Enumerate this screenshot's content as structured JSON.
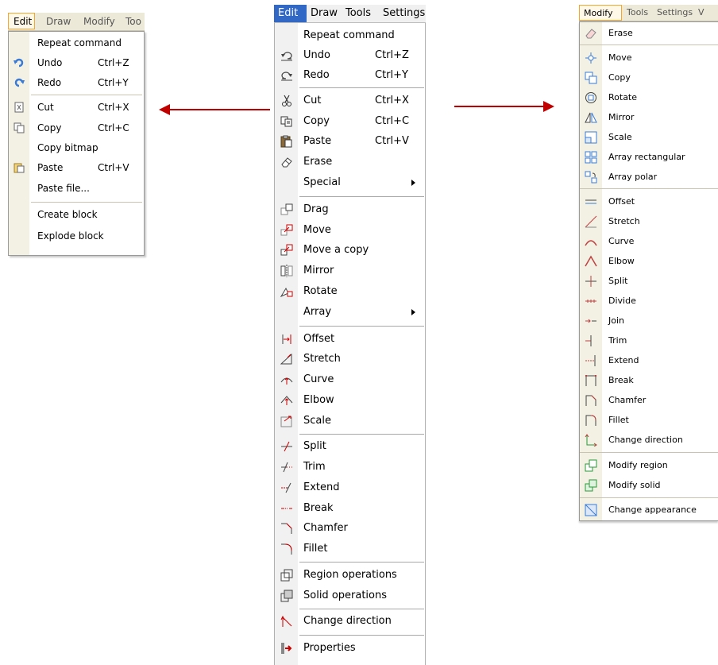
{
  "left_menu": {
    "menubar": [
      "Edit",
      "Draw",
      "Modify",
      "Too"
    ],
    "items": [
      {
        "label": "Repeat command",
        "shortcut": "",
        "icon": "none"
      },
      {
        "label": "Undo",
        "shortcut": "Ctrl+Z",
        "icon": "undo-icon"
      },
      {
        "label": "Redo",
        "shortcut": "Ctrl+Y",
        "icon": "redo-icon"
      },
      {
        "label": "Cut",
        "shortcut": "Ctrl+X",
        "icon": "cut-icon"
      },
      {
        "label": "Copy",
        "shortcut": "Ctrl+C",
        "icon": "copy-icon"
      },
      {
        "label": "Copy bitmap",
        "shortcut": "",
        "icon": "none"
      },
      {
        "label": "Paste",
        "shortcut": "Ctrl+V",
        "icon": "paste-icon"
      },
      {
        "label": "Paste file...",
        "shortcut": "",
        "icon": "none"
      },
      {
        "label": "Create block",
        "shortcut": "",
        "icon": "none"
      },
      {
        "label": "Explode block",
        "shortcut": "",
        "icon": "none"
      }
    ]
  },
  "center_menu": {
    "menubar": [
      "Edit",
      "Draw",
      "Tools",
      "Settings"
    ],
    "items": [
      {
        "label": "Repeat command",
        "shortcut": "",
        "icon": "none"
      },
      {
        "label": "Undo",
        "shortcut": "Ctrl+Z",
        "icon": "undo-icon"
      },
      {
        "label": "Redo",
        "shortcut": "Ctrl+Y",
        "icon": "redo-icon"
      },
      {
        "label": "Cut",
        "shortcut": "Ctrl+X",
        "icon": "scissors-icon"
      },
      {
        "label": "Copy",
        "shortcut": "Ctrl+C",
        "icon": "copy-icon"
      },
      {
        "label": "Paste",
        "shortcut": "Ctrl+V",
        "icon": "clipboard-icon"
      },
      {
        "label": "Erase",
        "shortcut": "",
        "icon": "eraser-icon"
      },
      {
        "label": "Special",
        "shortcut": "",
        "icon": "none",
        "submenu": true
      },
      {
        "label": "Drag",
        "shortcut": "",
        "icon": "drag-icon"
      },
      {
        "label": "Move",
        "shortcut": "",
        "icon": "move-icon"
      },
      {
        "label": "Move a copy",
        "shortcut": "",
        "icon": "move-copy-icon"
      },
      {
        "label": "Mirror",
        "shortcut": "",
        "icon": "mirror-icon"
      },
      {
        "label": "Rotate",
        "shortcut": "",
        "icon": "rotate-icon"
      },
      {
        "label": "Array",
        "shortcut": "",
        "icon": "none",
        "submenu": true
      },
      {
        "label": "Offset",
        "shortcut": "",
        "icon": "offset-icon"
      },
      {
        "label": "Stretch",
        "shortcut": "",
        "icon": "stretch-icon"
      },
      {
        "label": "Curve",
        "shortcut": "",
        "icon": "curve-icon"
      },
      {
        "label": "Elbow",
        "shortcut": "",
        "icon": "elbow-icon"
      },
      {
        "label": "Scale",
        "shortcut": "",
        "icon": "scale-icon"
      },
      {
        "label": "Split",
        "shortcut": "",
        "icon": "split-icon"
      },
      {
        "label": "Trim",
        "shortcut": "",
        "icon": "trim-icon"
      },
      {
        "label": "Extend",
        "shortcut": "",
        "icon": "extend-icon"
      },
      {
        "label": "Break",
        "shortcut": "",
        "icon": "break-icon"
      },
      {
        "label": "Chamfer",
        "shortcut": "",
        "icon": "chamfer-icon"
      },
      {
        "label": "Fillet",
        "shortcut": "",
        "icon": "fillet-icon"
      },
      {
        "label": "Region operations",
        "shortcut": "",
        "icon": "region-icon"
      },
      {
        "label": "Solid operations",
        "shortcut": "",
        "icon": "solid-icon"
      },
      {
        "label": "Change direction",
        "shortcut": "",
        "icon": "direction-icon"
      },
      {
        "label": "Properties",
        "shortcut": "",
        "icon": "properties-icon"
      }
    ]
  },
  "right_menu": {
    "menubar": [
      "Modify",
      "Tools",
      "Settings",
      "V"
    ],
    "items": [
      {
        "label": "Erase",
        "icon": "eraser-icon"
      },
      {
        "label": "Move",
        "icon": "move-icon"
      },
      {
        "label": "Copy",
        "icon": "copy-icon"
      },
      {
        "label": "Rotate",
        "icon": "rotate-icon"
      },
      {
        "label": "Mirror",
        "icon": "mirror-icon"
      },
      {
        "label": "Scale",
        "icon": "scale-icon"
      },
      {
        "label": "Array rectangular",
        "icon": "array-rect-icon"
      },
      {
        "label": "Array polar",
        "icon": "array-polar-icon"
      },
      {
        "label": "Offset",
        "icon": "offset-icon"
      },
      {
        "label": "Stretch",
        "icon": "stretch-icon"
      },
      {
        "label": "Curve",
        "icon": "curve-icon"
      },
      {
        "label": "Elbow",
        "icon": "elbow-icon"
      },
      {
        "label": "Split",
        "icon": "split-icon"
      },
      {
        "label": "Divide",
        "icon": "divide-icon"
      },
      {
        "label": "Join",
        "icon": "join-icon"
      },
      {
        "label": "Trim",
        "icon": "trim-icon"
      },
      {
        "label": "Extend",
        "icon": "extend-icon"
      },
      {
        "label": "Break",
        "icon": "break-icon"
      },
      {
        "label": "Chamfer",
        "icon": "chamfer-icon"
      },
      {
        "label": "Fillet",
        "icon": "fillet-icon"
      },
      {
        "label": "Change direction",
        "icon": "direction-icon"
      },
      {
        "label": "Modify region",
        "icon": "region-icon"
      },
      {
        "label": "Modify solid",
        "icon": "solid-icon"
      },
      {
        "label": "Change appearance",
        "icon": "appearance-icon"
      }
    ]
  },
  "colors": {
    "arrow": "#c00000",
    "active_menu_center": "#3168c5",
    "active_menu_xp": "#f0a830"
  }
}
